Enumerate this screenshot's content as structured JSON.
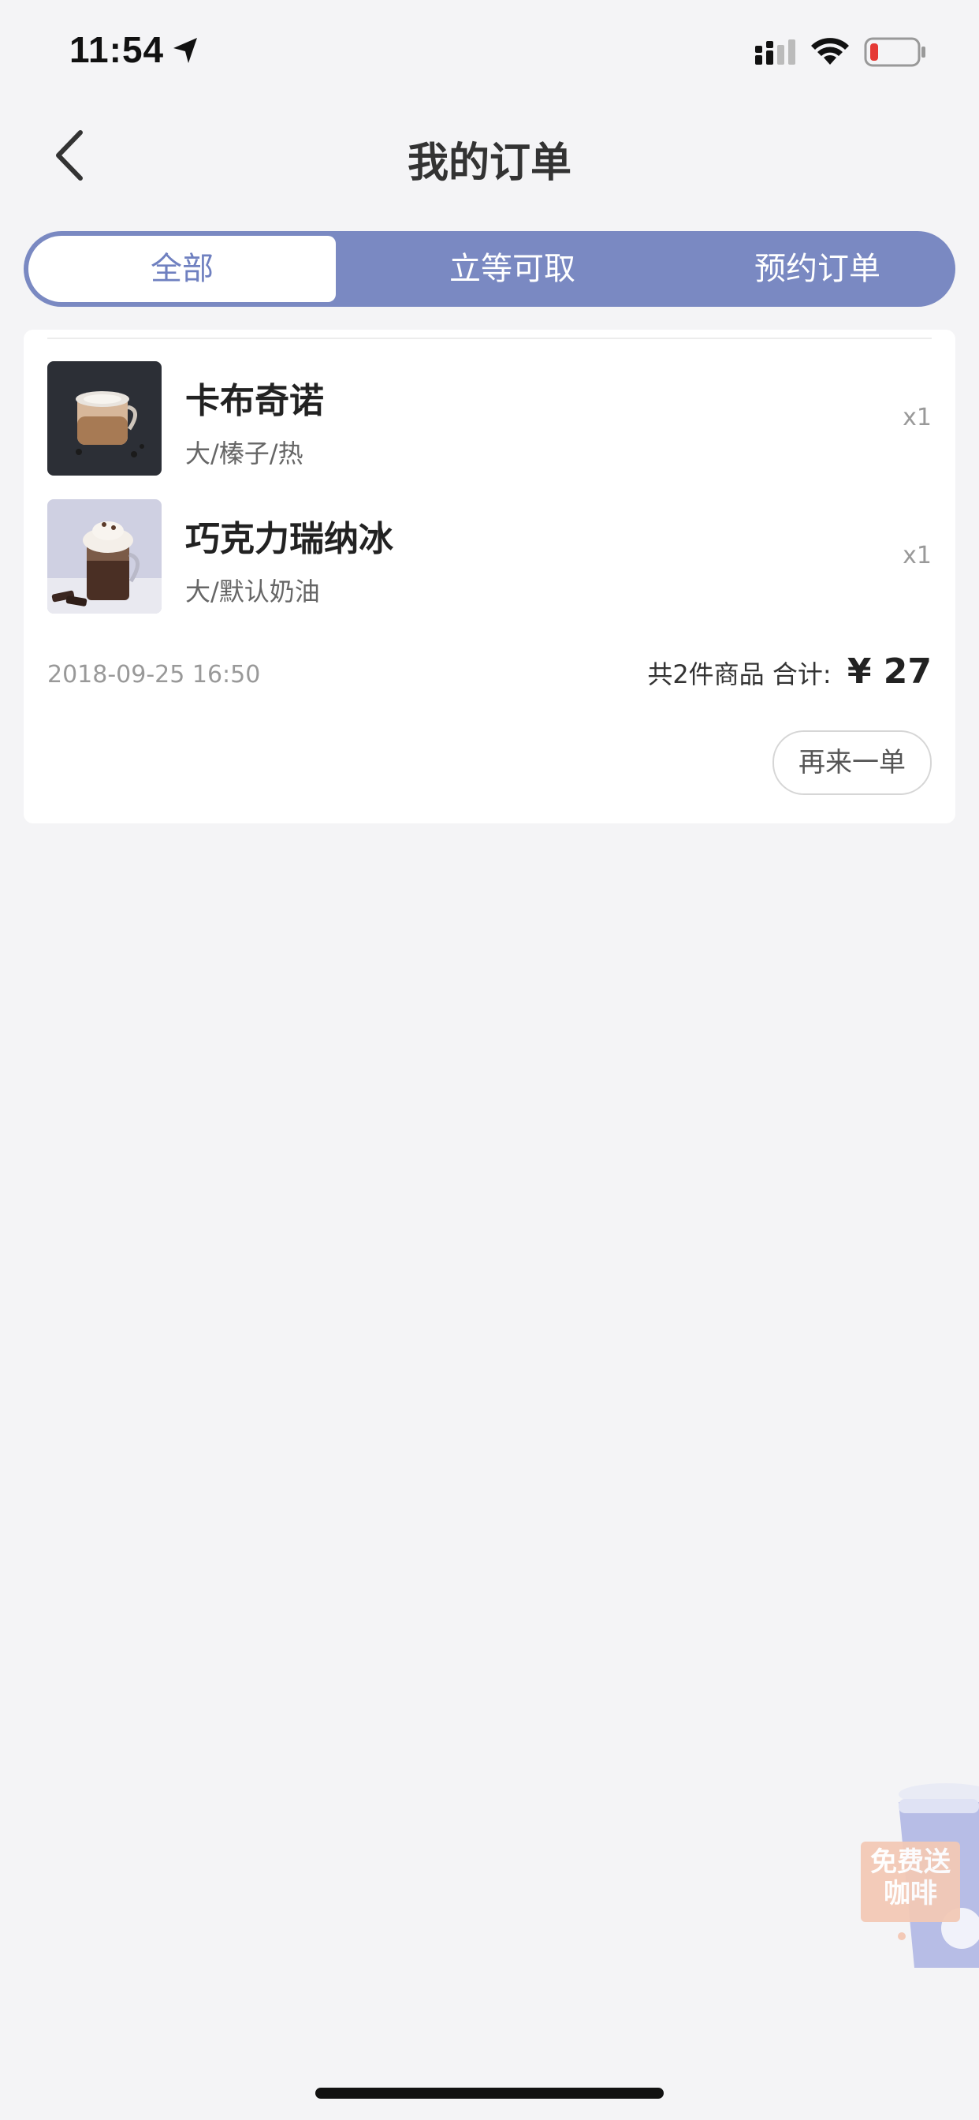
{
  "status_bar": {
    "time": "11:54"
  },
  "nav": {
    "title": "我的订单"
  },
  "tabs": [
    {
      "label": "全部",
      "selected": true
    },
    {
      "label": "立等可取",
      "selected": false
    },
    {
      "label": "预约订单",
      "selected": false
    }
  ],
  "order": {
    "items": [
      {
        "name": "卡布奇诺",
        "spec": "大/榛子/热",
        "qty": "x1"
      },
      {
        "name": "巧克力瑞纳冰",
        "spec": "大/默认奶油",
        "qty": "x1"
      }
    ],
    "time": "2018-09-25 16:50",
    "count_text": "共2件商品",
    "total_label": "合计:",
    "total_price": "¥ 27",
    "reorder_label": "再来一单"
  },
  "promo": {
    "label": "免费送咖啡"
  },
  "colors": {
    "accent": "#7a89c2",
    "background": "#f4f4f6"
  }
}
